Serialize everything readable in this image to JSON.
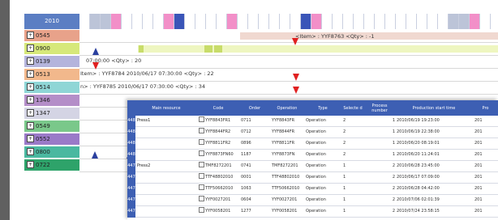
{
  "gantt": {
    "year": "2010",
    "rows": [
      {
        "code": "0545",
        "color": "#e8a28a"
      },
      {
        "code": "0900",
        "color": "#d6e87a"
      },
      {
        "code": "0139",
        "color": "#b4b4dc"
      },
      {
        "code": "0513",
        "color": "#f2b88c"
      },
      {
        "code": "0514",
        "color": "#8fd6d6"
      },
      {
        "code": "1346",
        "color": "#b48ec8"
      },
      {
        "code": "1347",
        "color": "#d4d4e4"
      },
      {
        "code": "0549",
        "color": "#7ac88a"
      },
      {
        "code": "0552",
        "color": "#9a7ac8"
      },
      {
        "code": "0800",
        "color": "#4ab8a0"
      },
      {
        "code": "0722",
        "color": "#2ea36a"
      }
    ],
    "labels": {
      "row0": "<Item> : YYF8763    <Qty> : -1",
      "row2": "07:00:00    <Qty> : 20",
      "row3": "Item> : YYF8784 2010/06/17 07:30:00    <Qty> : 22",
      "row4": "n> : YYF8785 2010/06/17 07:30:00    <Qty> : 34"
    }
  },
  "table": {
    "headers": [
      "Main resource",
      "Code",
      "Order",
      "Operation",
      "Type",
      "Selecte d",
      "Process number",
      "Production start time",
      "Pro"
    ],
    "rows": [
      {
        "idx": "448",
        "resource": "Press1",
        "code": "YYF8843FR1",
        "order": "0711",
        "operation": "YYF8843FR",
        "type": "Operation",
        "selected": "2",
        "process": "1",
        "start": "2010/06/19 19:23:00",
        "pro": "201"
      },
      {
        "idx": "448",
        "resource": "",
        "code": "YYF8844FR2",
        "order": "0712",
        "operation": "YYF8844FR",
        "type": "Operation",
        "selected": "2",
        "process": "1",
        "start": "2010/06/19 22:38:00",
        "pro": "201"
      },
      {
        "idx": "448",
        "resource": "",
        "code": "YYF8811FR2",
        "order": "0896",
        "operation": "YYF8811FR",
        "type": "Operation",
        "selected": "2",
        "process": "1",
        "start": "2010/06/20 08:19:01",
        "pro": "201"
      },
      {
        "idx": "448",
        "resource": "",
        "code": "YYF8873FN60",
        "order": "1187",
        "operation": "YYF8873FN",
        "type": "Operation",
        "selected": "2",
        "process": "1",
        "start": "2010/06/20 11:24:01",
        "pro": "201"
      },
      {
        "idx": "447",
        "resource": "Press2",
        "code": "TMF8272201",
        "order": "0741",
        "operation": "TMF8272201",
        "type": "Operation",
        "selected": "1",
        "process": "2",
        "start": "2010/06/28 23:45:00",
        "pro": "201"
      },
      {
        "idx": "447",
        "resource": "",
        "code": "TTF48802010",
        "order": "0001",
        "operation": "TTF48802010",
        "type": "Operation",
        "selected": "1",
        "process": "2",
        "start": "2010/06/17 07:09:00",
        "pro": "201"
      },
      {
        "idx": "447",
        "resource": "",
        "code": "TTF50662010",
        "order": "1063",
        "operation": "TTF50662010",
        "type": "Operation",
        "selected": "1",
        "process": "2",
        "start": "2010/06/28 04:42:00",
        "pro": "201"
      },
      {
        "idx": "447",
        "resource": "",
        "code": "YYF0027201",
        "order": "0604",
        "operation": "YYF0027201",
        "type": "Operation",
        "selected": "1",
        "process": "2",
        "start": "2010/07/06 02:01:39",
        "pro": "201"
      },
      {
        "idx": "447",
        "resource": "",
        "code": "YYF0058201",
        "order": "1277",
        "operation": "YYF0058201",
        "type": "Operation",
        "selected": "1",
        "process": "2",
        "start": "2010/07/24 23:58:15",
        "pro": "201"
      }
    ]
  }
}
